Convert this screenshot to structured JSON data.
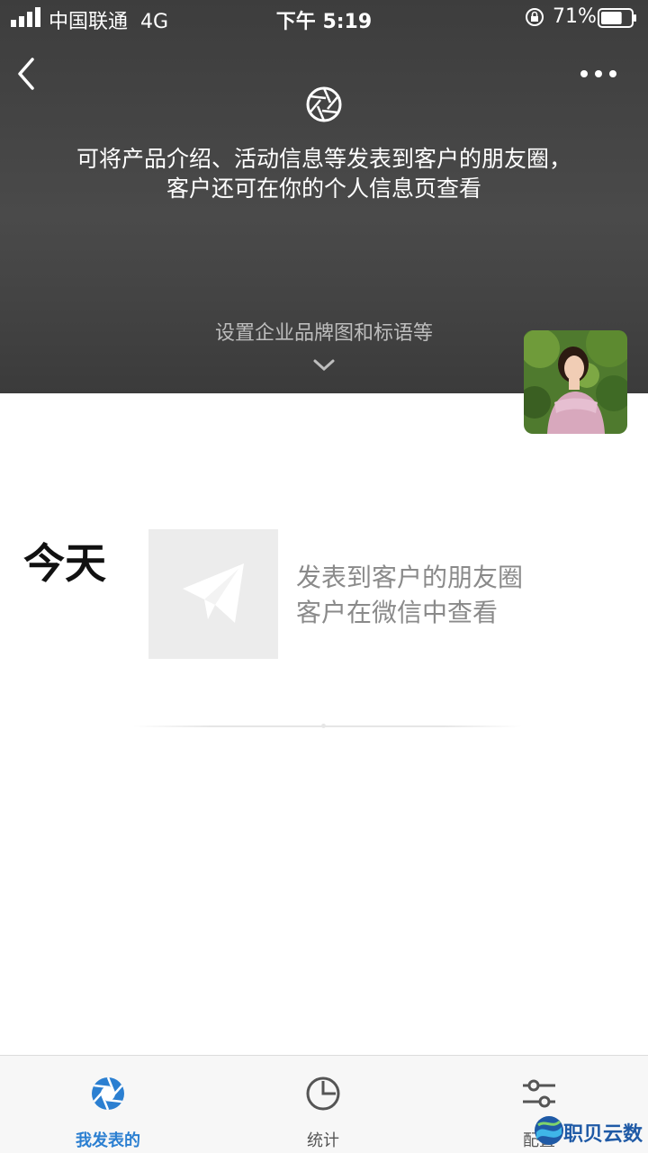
{
  "status_bar": {
    "carrier": "中国联通",
    "network": "4G",
    "time": "下午 5:19",
    "battery_percent": "71%",
    "battery_level": 0.71
  },
  "header": {
    "intro_text": "可将产品介绍、活动信息等发表到客户的朋友圈，客户还可在你的个人信息页查看",
    "brand_setting_label": "设置企业品牌图和标语等",
    "icons": [
      "back-icon",
      "more-icon",
      "aperture-icon",
      "chevron-down-icon"
    ]
  },
  "feed": {
    "today_label": "今天",
    "post_desc_line1": "发表到客户的朋友圈",
    "post_desc_line2": "客户在微信中查看"
  },
  "tabbar": {
    "tabs": [
      {
        "label": "我发表的",
        "icon": "aperture-icon",
        "active": true
      },
      {
        "label": "统计",
        "icon": "pie-chart-icon",
        "active": false
      },
      {
        "label": "配置",
        "icon": "sliders-icon",
        "active": false
      }
    ]
  },
  "watermark": {
    "text": "职贝云数"
  },
  "colors": {
    "header_bg": "#444444",
    "accent": "#2b7fd1",
    "tabbar_bg": "#f7f7f7"
  }
}
